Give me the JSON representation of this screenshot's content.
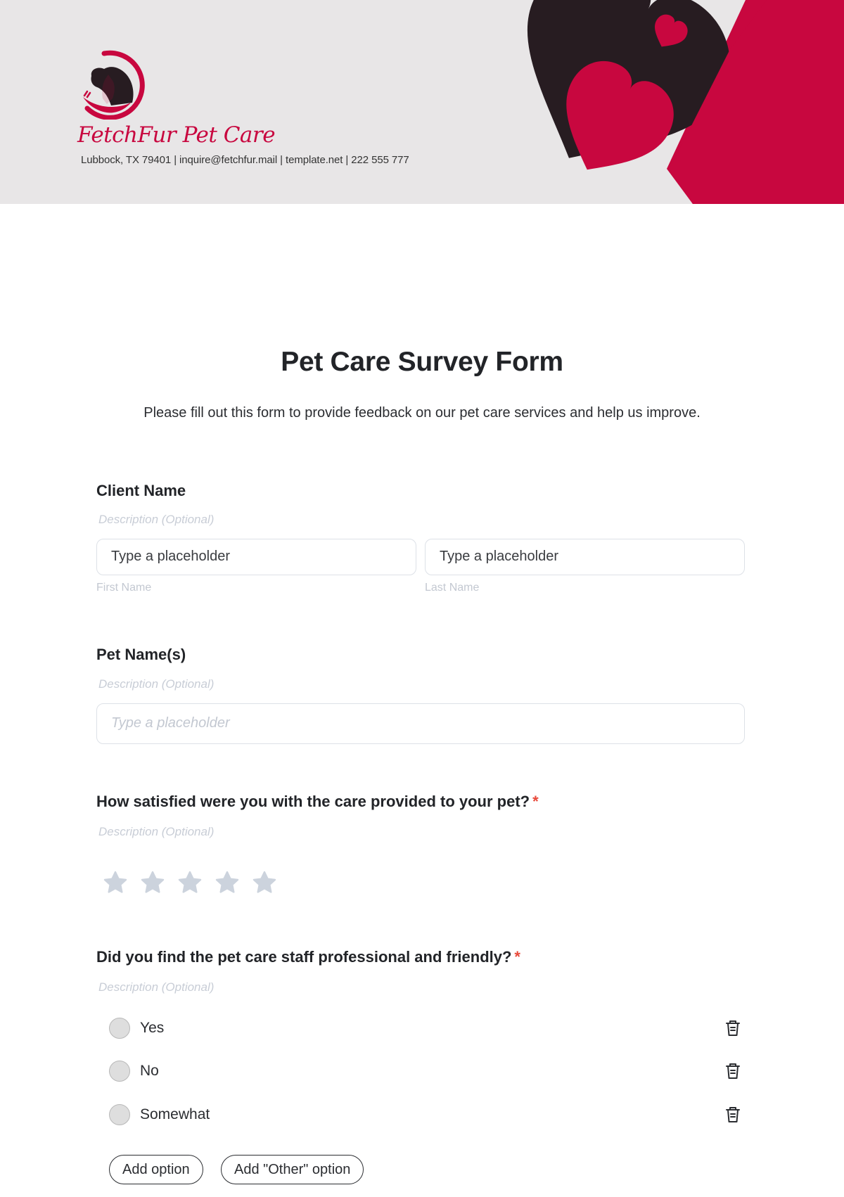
{
  "header": {
    "brand_name": "FetchFur Pet Care",
    "contact_line": "Lubbock, TX 79401 | inquire@fetchfur.mail | template.net | 222 555 777",
    "colors": {
      "accent": "#c8073f",
      "dark": "#271c21",
      "background": "#e8e6e7"
    }
  },
  "form": {
    "title": "Pet Care Survey Form",
    "subtitle": "Please fill out this form to provide feedback on our pet care services and help us improve."
  },
  "questions": [
    {
      "label": "Client Name",
      "required": false,
      "description_placeholder": "Description (Optional)",
      "fields": [
        {
          "placeholder": "Type a placeholder",
          "sublabel": "First Name"
        },
        {
          "placeholder": "Type a placeholder",
          "sublabel": "Last Name"
        }
      ]
    },
    {
      "label": "Pet Name(s)",
      "required": false,
      "description_placeholder": "Description (Optional)",
      "fields": [
        {
          "placeholder": "Type a placeholder"
        }
      ]
    },
    {
      "label": "How satisfied were you with the care provided to your pet?",
      "required": true,
      "required_mark": "*",
      "description_placeholder": "Description (Optional)",
      "rating": {
        "max": 5,
        "value": 0,
        "star_color": "#ccd3dd"
      }
    },
    {
      "label": "Did you find the pet care staff professional and friendly?",
      "required": true,
      "required_mark": "*",
      "description_placeholder": "Description (Optional)",
      "options": [
        "Yes",
        "No",
        "Somewhat"
      ],
      "add_option_label": "Add option",
      "add_other_label": "Add \"Other\" option"
    }
  ]
}
